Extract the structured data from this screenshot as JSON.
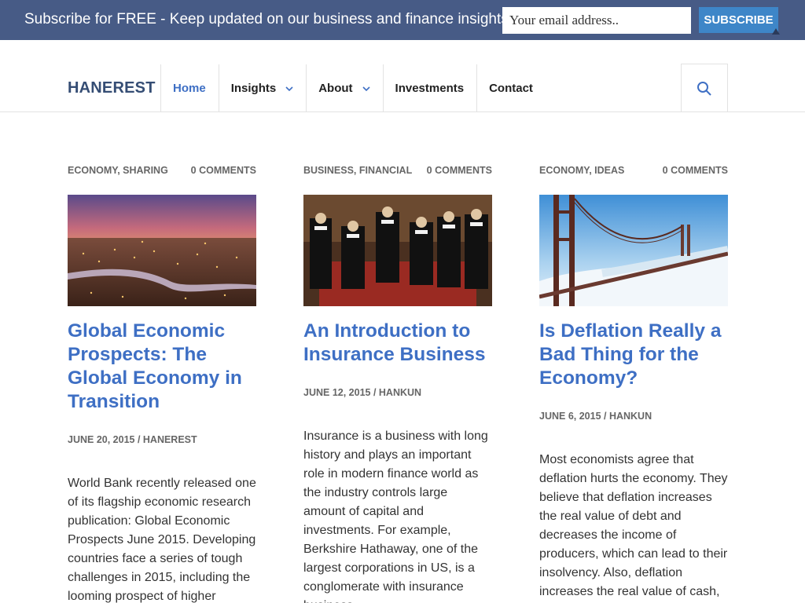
{
  "subscribe_bar": {
    "text": "Subscribe for FREE - Keep updated on our business and finance insights",
    "email_placeholder": "Your email address..",
    "button_label": "SUBSCRIBE"
  },
  "header": {
    "logo": "HANEREST",
    "nav": [
      {
        "label": "Home"
      },
      {
        "label": "Insights"
      },
      {
        "label": "About"
      },
      {
        "label": "Investments"
      },
      {
        "label": "Contact"
      }
    ]
  },
  "posts": [
    {
      "categories": "ECONOMY, SHARING",
      "comments": "0 COMMENTS",
      "image": "city-skyline-at-dusk",
      "title": "Global Economic Prospects: The Global Economy in Transition",
      "byline": "JUNE 20, 2015 / HANEREST",
      "excerpt": "World Bank recently released one of its flagship economic research publication: Global Economic Prospects June 2015. Developing countries face a series of tough challenges in 2015, including the looming prospect of higher"
    },
    {
      "categories": "BUSINESS, FINANCIAL",
      "comments": "0 COMMENTS",
      "image": "group-portrait-painting",
      "title": "An Introduction to Insurance Business",
      "byline": "JUNE 12, 2015 / HANKUN",
      "excerpt": "Insurance is a business with long history and plays an important role in modern finance world as the industry controls large amount of capital and investments. For example, Berkshire Hathaway, one of the largest corporations in US, is a conglomerate with insurance business…"
    },
    {
      "categories": "ECONOMY, IDEAS",
      "comments": "0 COMMENTS",
      "image": "bridge-in-fog",
      "title": "Is Deflation Really a Bad Thing for the Economy?",
      "byline": "JUNE 6, 2015 / HANKUN",
      "excerpt": "Most economists agree that deflation hurts the economy. They believe that deflation increases the real value of debt and decreases the income of producers, which can lead to their insolvency. Also, deflation increases the real value of cash,"
    }
  ],
  "colors": {
    "bar_bg": "#475b86",
    "button_bg": "#3e86c8",
    "link": "#3e6fc4",
    "logo": "#354d74"
  }
}
